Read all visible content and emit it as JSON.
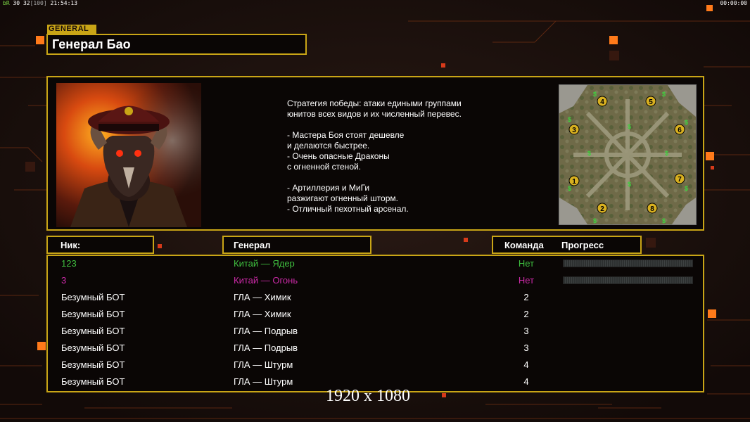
{
  "status_bar": {
    "left_prefix": "bR",
    "left_fps": "30",
    "left_count": "32",
    "left_bracket": "[100]",
    "left_time": "21:54:13",
    "right_time": "00:00:00"
  },
  "general": {
    "tag": "GENERAL",
    "name": "Генерал Бао",
    "portrait_icon": "demon-general-portrait",
    "strategy_lines": [
      "Стратегия победы: атаки едиными группами",
      "юнитов всех видов и их численный перевес.",
      "",
      "- Мастера Боя стоят дешевле",
      "и делаются быстрее.",
      "- Очень опасные Драконы",
      "с огненной стеной.",
      "",
      "- Артиллерия и МиГи",
      "разжигают огненный шторм.",
      "- Отличный пехотный арсенал."
    ]
  },
  "minimap": {
    "start_positions": [
      "1",
      "2",
      "3",
      "4",
      "5",
      "6",
      "7",
      "8"
    ],
    "resource_marker": "$"
  },
  "columns": {
    "nick": "Ник:",
    "general": "Генерал",
    "team": "Команда",
    "progress": "Прогресс"
  },
  "players": [
    {
      "nick": "123",
      "general": "Китай — Ядер",
      "team": "Нет",
      "color": "#3fbf3f",
      "show_progress": true
    },
    {
      "nick": "3",
      "general": "Китай — Огонь",
      "team": "Нет",
      "color": "#cc2aa8",
      "show_progress": true
    },
    {
      "nick": "Безумный БОТ",
      "general": "ГЛА — Химик",
      "team": "2",
      "color": "#ffffff",
      "show_progress": false
    },
    {
      "nick": "Безумный БОТ",
      "general": "ГЛА — Химик",
      "team": "2",
      "color": "#ffffff",
      "show_progress": false
    },
    {
      "nick": "Безумный БОТ",
      "general": "ГЛА — Подрыв",
      "team": "3",
      "color": "#ffffff",
      "show_progress": false
    },
    {
      "nick": "Безумный БОТ",
      "general": "ГЛА — Подрыв",
      "team": "3",
      "color": "#ffffff",
      "show_progress": false
    },
    {
      "nick": "Безумный БОТ",
      "general": "ГЛА — Штурм",
      "team": "4",
      "color": "#ffffff",
      "show_progress": false
    },
    {
      "nick": "Безумный БОТ",
      "general": "ГЛА — Штурм",
      "team": "4",
      "color": "#ffffff",
      "show_progress": false
    }
  ],
  "resolution_text": "1920 x 1080",
  "colors": {
    "accent": "#c9a516",
    "background": "#1a0f0c",
    "ornament": "#ff7a1a"
  }
}
